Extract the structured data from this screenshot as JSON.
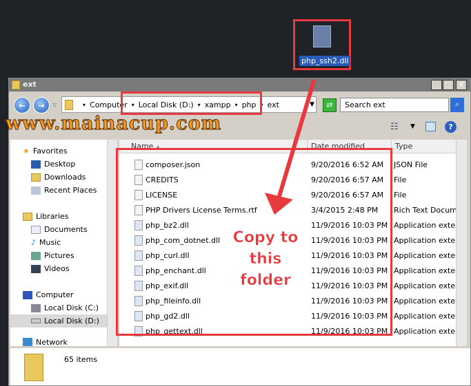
{
  "desktop_file": {
    "label": "php_ssh2.dll"
  },
  "window": {
    "title": "ext",
    "controls": {
      "minimize": "_",
      "maximize": "□",
      "close": "X"
    }
  },
  "address": {
    "crumbs": [
      "Computer",
      "Local Disk (D:)",
      "xampp",
      "php",
      "ext"
    ]
  },
  "search": {
    "placeholder": "Search ext"
  },
  "watermark": "www.mainacup.com",
  "nav": {
    "favorites": "Favorites",
    "fav_items": [
      "Desktop",
      "Downloads",
      "Recent Places"
    ],
    "libraries": "Libraries",
    "lib_items": [
      "Documents",
      "Music",
      "Pictures",
      "Videos"
    ],
    "computer": "Computer",
    "drives": [
      "Local Disk (C:)",
      "Local Disk (D:)"
    ],
    "network": "Network",
    "selected": "Local Disk (D:)"
  },
  "columns": {
    "name": "Name",
    "date": "Date modified",
    "type": "Type"
  },
  "files": [
    {
      "name": "composer.json",
      "date": "9/20/2016 6:52 AM",
      "type": "JSON File"
    },
    {
      "name": "CREDITS",
      "date": "9/20/2016 6:57 AM",
      "type": "File"
    },
    {
      "name": "LICENSE",
      "date": "9/20/2016 6:57 AM",
      "type": "File"
    },
    {
      "name": "PHP Drivers License Terms.rtf",
      "date": "3/4/2015 2:48 PM",
      "type": "Rich Text Document"
    },
    {
      "name": "php_bz2.dll",
      "date": "11/9/2016 10:03 PM",
      "type": "Application extension"
    },
    {
      "name": "php_com_dotnet.dll",
      "date": "11/9/2016 10:03 PM",
      "type": "Application extension"
    },
    {
      "name": "php_curl.dll",
      "date": "11/9/2016 10:03 PM",
      "type": "Application extension"
    },
    {
      "name": "php_enchant.dll",
      "date": "11/9/2016 10:03 PM",
      "type": "Application extension"
    },
    {
      "name": "php_exif.dll",
      "date": "11/9/2016 10:03 PM",
      "type": "Application extension"
    },
    {
      "name": "php_fileinfo.dll",
      "date": "11/9/2016 10:03 PM",
      "type": "Application extension"
    },
    {
      "name": "php_gd2.dll",
      "date": "11/9/2016 10:03 PM",
      "type": "Application extension"
    },
    {
      "name": "php_gettext.dll",
      "date": "11/9/2016 10:03 PM",
      "type": "Application extension"
    }
  ],
  "status": {
    "count": "65 items"
  },
  "annotation": {
    "line1": "Copy to",
    "line2": "this",
    "line3": "folder",
    "color": "#e8393f"
  }
}
